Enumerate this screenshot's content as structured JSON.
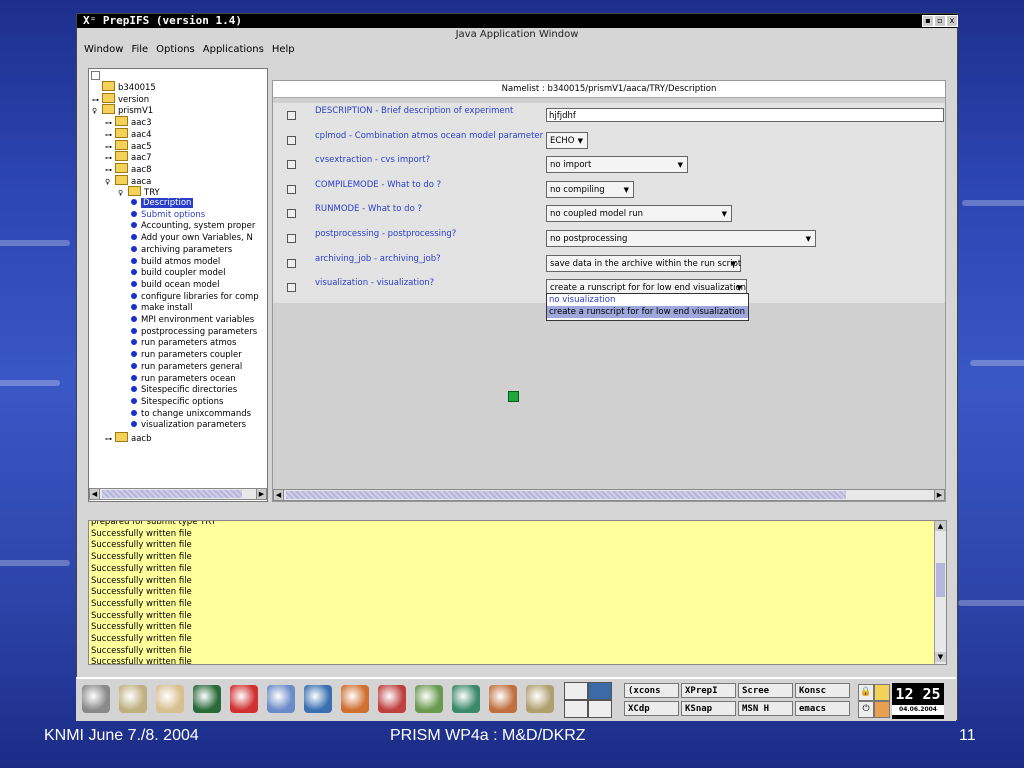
{
  "window": {
    "title": "PrepIFS (version 1.4)",
    "subtitle": "Java Application Window",
    "buttons": [
      "▪",
      "▫",
      "x"
    ]
  },
  "menu": [
    "Window",
    "File",
    "Options",
    "Applications",
    "Help"
  ],
  "tree": {
    "items": [
      {
        "label": "b340015",
        "kind": "folder",
        "exp": ""
      },
      {
        "label": "version",
        "kind": "folder",
        "exp": "⊶"
      },
      {
        "label": "prismV1",
        "kind": "folder",
        "exp": "♀"
      },
      {
        "label": "aac3",
        "kind": "folder",
        "exp": "⊶"
      },
      {
        "label": "aac4",
        "kind": "folder",
        "exp": "⊶"
      },
      {
        "label": "aac5",
        "kind": "folder",
        "exp": "⊶"
      },
      {
        "label": "aac7",
        "kind": "folder",
        "exp": "⊶"
      },
      {
        "label": "aac8",
        "kind": "folder",
        "exp": "⊶"
      },
      {
        "label": "aaca",
        "kind": "folder",
        "exp": "♀"
      },
      {
        "label": "TRY",
        "kind": "folder",
        "exp": "♀"
      },
      {
        "label": "Description",
        "kind": "leaf",
        "state": "selected"
      },
      {
        "label": "Submit options",
        "kind": "leaf",
        "state": "blue"
      },
      {
        "label": "Accounting, system proper",
        "kind": "leaf"
      },
      {
        "label": "Add your own Variables, N",
        "kind": "leaf"
      },
      {
        "label": "archiving parameters",
        "kind": "leaf"
      },
      {
        "label": "build atmos model",
        "kind": "leaf"
      },
      {
        "label": "build coupler model",
        "kind": "leaf"
      },
      {
        "label": "build ocean model",
        "kind": "leaf"
      },
      {
        "label": "configure libraries for comp",
        "kind": "leaf"
      },
      {
        "label": "make install",
        "kind": "leaf"
      },
      {
        "label": "MPI environment variables",
        "kind": "leaf"
      },
      {
        "label": "postprocessing parameters",
        "kind": "leaf"
      },
      {
        "label": "run parameters atmos",
        "kind": "leaf"
      },
      {
        "label": "run parameters coupler",
        "kind": "leaf"
      },
      {
        "label": "run parameters general",
        "kind": "leaf"
      },
      {
        "label": "run parameters ocean",
        "kind": "leaf"
      },
      {
        "label": "Sitespecific directories",
        "kind": "leaf"
      },
      {
        "label": "Sitespecific options",
        "kind": "leaf"
      },
      {
        "label": "to change unixcommands",
        "kind": "leaf"
      },
      {
        "label": "visualization parameters",
        "kind": "leaf"
      },
      {
        "label": "aacb",
        "kind": "folder",
        "exp": "⊶"
      }
    ]
  },
  "namelist": {
    "header": "Namelist : b340015/prismV1/aaca/TRY/Description",
    "params": [
      {
        "label": "DESCRIPTION - Brief description of experiment",
        "type": "input",
        "value": "hjfjdhf"
      },
      {
        "label": "cplmod - Combination atmos ocean model parameter",
        "type": "select",
        "value": "ECHO"
      },
      {
        "label": "cvsextraction - cvs import?",
        "type": "select",
        "value": "no import"
      },
      {
        "label": "COMPILEMODE - What to do ?",
        "type": "select",
        "value": "no compiling"
      },
      {
        "label": "RUNMODE - What to do ?",
        "type": "select",
        "value": "no coupled model run"
      },
      {
        "label": "postprocessing - postprocessing?",
        "type": "select",
        "value": "no postprocessing"
      },
      {
        "label": "archiving_job - archiving_job?",
        "type": "select",
        "value": "save data in the archive within the run script"
      },
      {
        "label": "visualization - visualization?",
        "type": "select",
        "value": "create a runscript for for low end visualization"
      }
    ],
    "dropdown_options": [
      "no visualization",
      "create a runscript for for low end visualization"
    ]
  },
  "log": {
    "lines": [
      "prepared for submit type TRY",
      "Successfully written file",
      "Successfully written file",
      "Successfully written file",
      "Successfully written file",
      "Successfully written file",
      "Successfully written file",
      "Successfully written file",
      "Successfully written file",
      "Successfully written file",
      "Successfully written file",
      "Successfully written file",
      "Successfully written file"
    ]
  },
  "taskbar": {
    "launcher_icons": [
      "kde-gear-icon",
      "home-icon",
      "shell-icon",
      "terminal-icon",
      "help-lifebuoy-icon",
      "kmail-icon",
      "browser-icon",
      "office-icon",
      "paint-icon",
      "spreadsheet-icon",
      "chart-icon",
      "presentation-icon",
      "editor-icon"
    ],
    "tasks": [
      {
        "label": "(xcons"
      },
      {
        "label": "XPrepI"
      },
      {
        "label": "Scree"
      },
      {
        "label": "Konsc"
      },
      {
        "label": "XCdp"
      },
      {
        "label": "KSnap"
      },
      {
        "label": "MSN H"
      },
      {
        "label": "emacs"
      }
    ],
    "clock_time": "12 25",
    "clock_date": "04.06.2004"
  },
  "footer": {
    "left": "KNMI June 7./8. 2004",
    "center": "PRISM WP4a :  M&D/DKRZ",
    "right": "11"
  },
  "colors": {
    "accent_blue": "#2a3ec8",
    "log_background": "#ffff9c",
    "selection": "#9fa8dc"
  }
}
